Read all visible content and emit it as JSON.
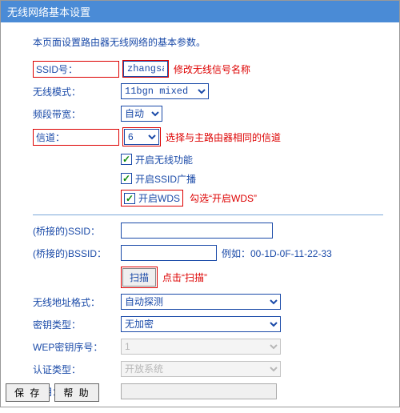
{
  "header": {
    "title": "无线网络基本设置"
  },
  "desc": "本页面设置路由器无线网络的基本参数。",
  "fields": {
    "ssid_label": "SSID号：",
    "ssid_value": "zhangsan",
    "ssid_note": "修改无线信号名称",
    "mode_label": "无线模式：",
    "mode_value": "11bgn mixed",
    "bandwidth_label": "频段带宽：",
    "bandwidth_value": "自动",
    "channel_label": "信道：",
    "channel_value": "6",
    "channel_note": "选择与主路由器相同的信道",
    "cb_wifi": "开启无线功能",
    "cb_ssid_broadcast": "开启SSID广播",
    "cb_wds": "开启WDS",
    "wds_note": "勾选“开启WDS”",
    "bridge_ssid_label": "(桥接的)SSID：",
    "bridge_ssid_value": "",
    "bridge_bssid_label": "(桥接的)BSSID：",
    "bridge_bssid_value": "",
    "bssid_example": "例如：00-1D-0F-11-22-33",
    "scan_label": "扫描",
    "scan_note": "点击“扫描”",
    "addr_fmt_label": "无线地址格式：",
    "addr_fmt_value": "自动探测",
    "key_type_label": "密钥类型：",
    "key_type_value": "无加密",
    "wep_index_label": "WEP密钥序号：",
    "wep_index_value": "1",
    "auth_type_label": "认证类型：",
    "auth_type_value": "开放系统",
    "key_label": "密钥：",
    "key_value": ""
  },
  "footer": {
    "save": "保 存",
    "help": "帮 助"
  }
}
